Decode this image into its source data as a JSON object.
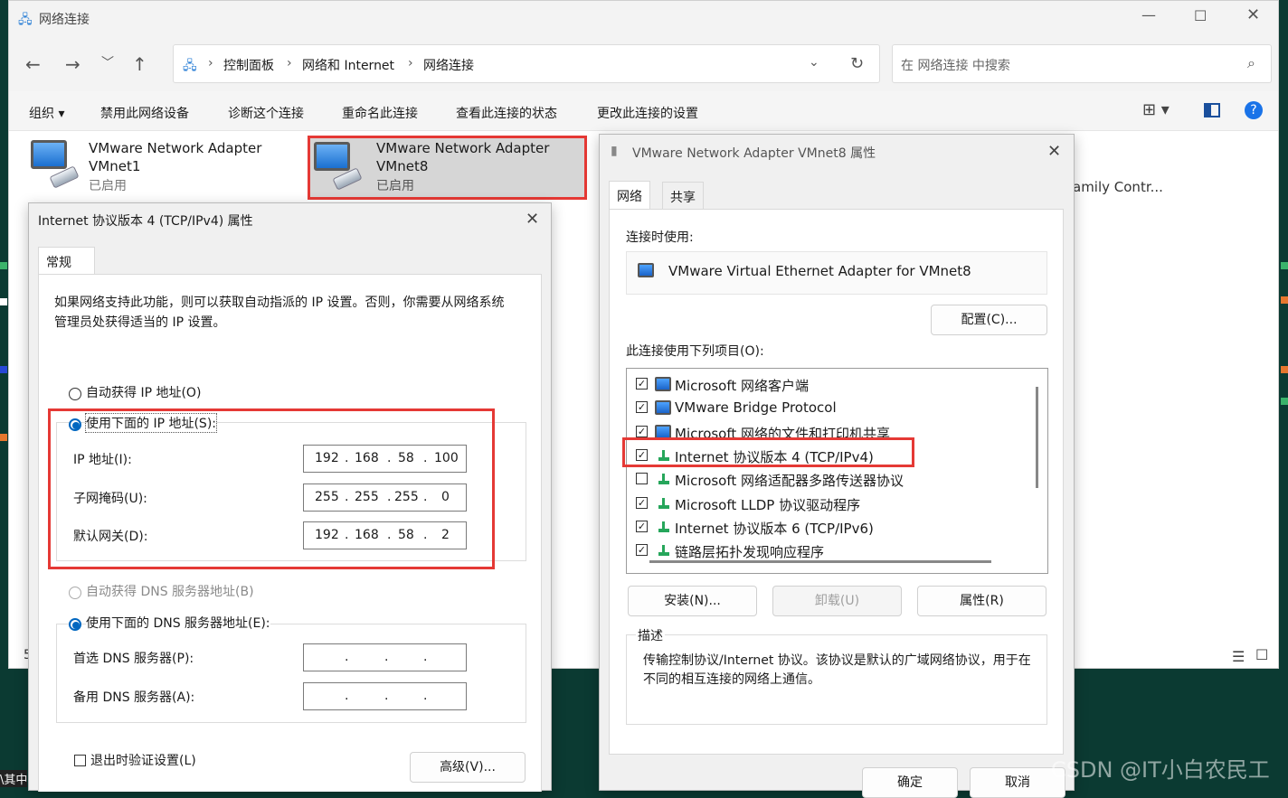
{
  "explorer": {
    "title": "网络连接",
    "breadcrumb": [
      "控制面板",
      "网络和 Internet",
      "网络连接"
    ],
    "search_placeholder": "在 网络连接 中搜索",
    "commands": [
      "组织",
      "禁用此网络设备",
      "诊断这个连接",
      "重命名此连接",
      "查看此连接的状态",
      "更改此连接的设置"
    ],
    "adapters": [
      {
        "name": "VMware Network Adapter",
        "sub": "VMnet1",
        "status": "已启用"
      },
      {
        "name": "VMware Network Adapter",
        "sub": "VMnet8",
        "status": "已启用"
      }
    ],
    "partial_text": "amily Contr...",
    "left_fragment": "5",
    "bottom_left_fragment": "\\其中"
  },
  "ipv4_dialog": {
    "title": "Internet 协议版本 4 (TCP/IPv4) 属性",
    "tab": "常规",
    "intro": "如果网络支持此功能，则可以获取自动指派的 IP 设置。否则，你需要从网络系统管理员处获得适当的 IP 设置。",
    "auto_ip": "自动获得 IP 地址(O)",
    "manual_ip": "使用下面的 IP 地址(S):",
    "ip_label": "IP 地址(I):",
    "ip_value": [
      "192",
      "168",
      "58",
      "100"
    ],
    "mask_label": "子网掩码(U):",
    "mask_value": [
      "255",
      "255",
      "255",
      "0"
    ],
    "gw_label": "默认网关(D):",
    "gw_value": [
      "192",
      "168",
      "58",
      "2"
    ],
    "auto_dns": "自动获得 DNS 服务器地址(B)",
    "manual_dns": "使用下面的 DNS 服务器地址(E):",
    "dns1_label": "首选 DNS 服务器(P):",
    "dns2_label": "备用 DNS 服务器(A):",
    "validate": "退出时验证设置(L)",
    "advanced": "高级(V)..."
  },
  "vmnet8_dialog": {
    "title": "VMware Network Adapter VMnet8 属性",
    "tabs": [
      "网络",
      "共享"
    ],
    "connect_using_label": "连接时使用:",
    "adapter_name": "VMware Virtual Ethernet Adapter for VMnet8",
    "configure": "配置(C)...",
    "items_label": "此连接使用下列项目(O):",
    "items": [
      {
        "label": "Microsoft 网络客户端",
        "checked": true,
        "icon": "network-icon"
      },
      {
        "label": "VMware Bridge Protocol",
        "checked": true,
        "icon": "network-icon"
      },
      {
        "label": "Microsoft 网络的文件和打印机共享",
        "checked": true,
        "icon": "network-icon"
      },
      {
        "label": "Internet 协议版本 4 (TCP/IPv4)",
        "checked": true,
        "icon": "protocol-icon"
      },
      {
        "label": "Microsoft 网络适配器多路传送器协议",
        "checked": false,
        "icon": "protocol-icon"
      },
      {
        "label": "Microsoft LLDP 协议驱动程序",
        "checked": true,
        "icon": "protocol-icon"
      },
      {
        "label": "Internet 协议版本 6 (TCP/IPv6)",
        "checked": true,
        "icon": "protocol-icon"
      },
      {
        "label": "链路层拓扑发现响应程序",
        "checked": true,
        "icon": "protocol-icon"
      }
    ],
    "install": "安装(N)...",
    "uninstall": "卸载(U)",
    "properties": "属性(R)",
    "desc_label": "描述",
    "description": "传输控制协议/Internet 协议。该协议是默认的广域网络协议，用于在不同的相互连接的网络上通信。",
    "ok": "确定",
    "cancel": "取消"
  },
  "watermark": "CSDN @IT小白农民工"
}
